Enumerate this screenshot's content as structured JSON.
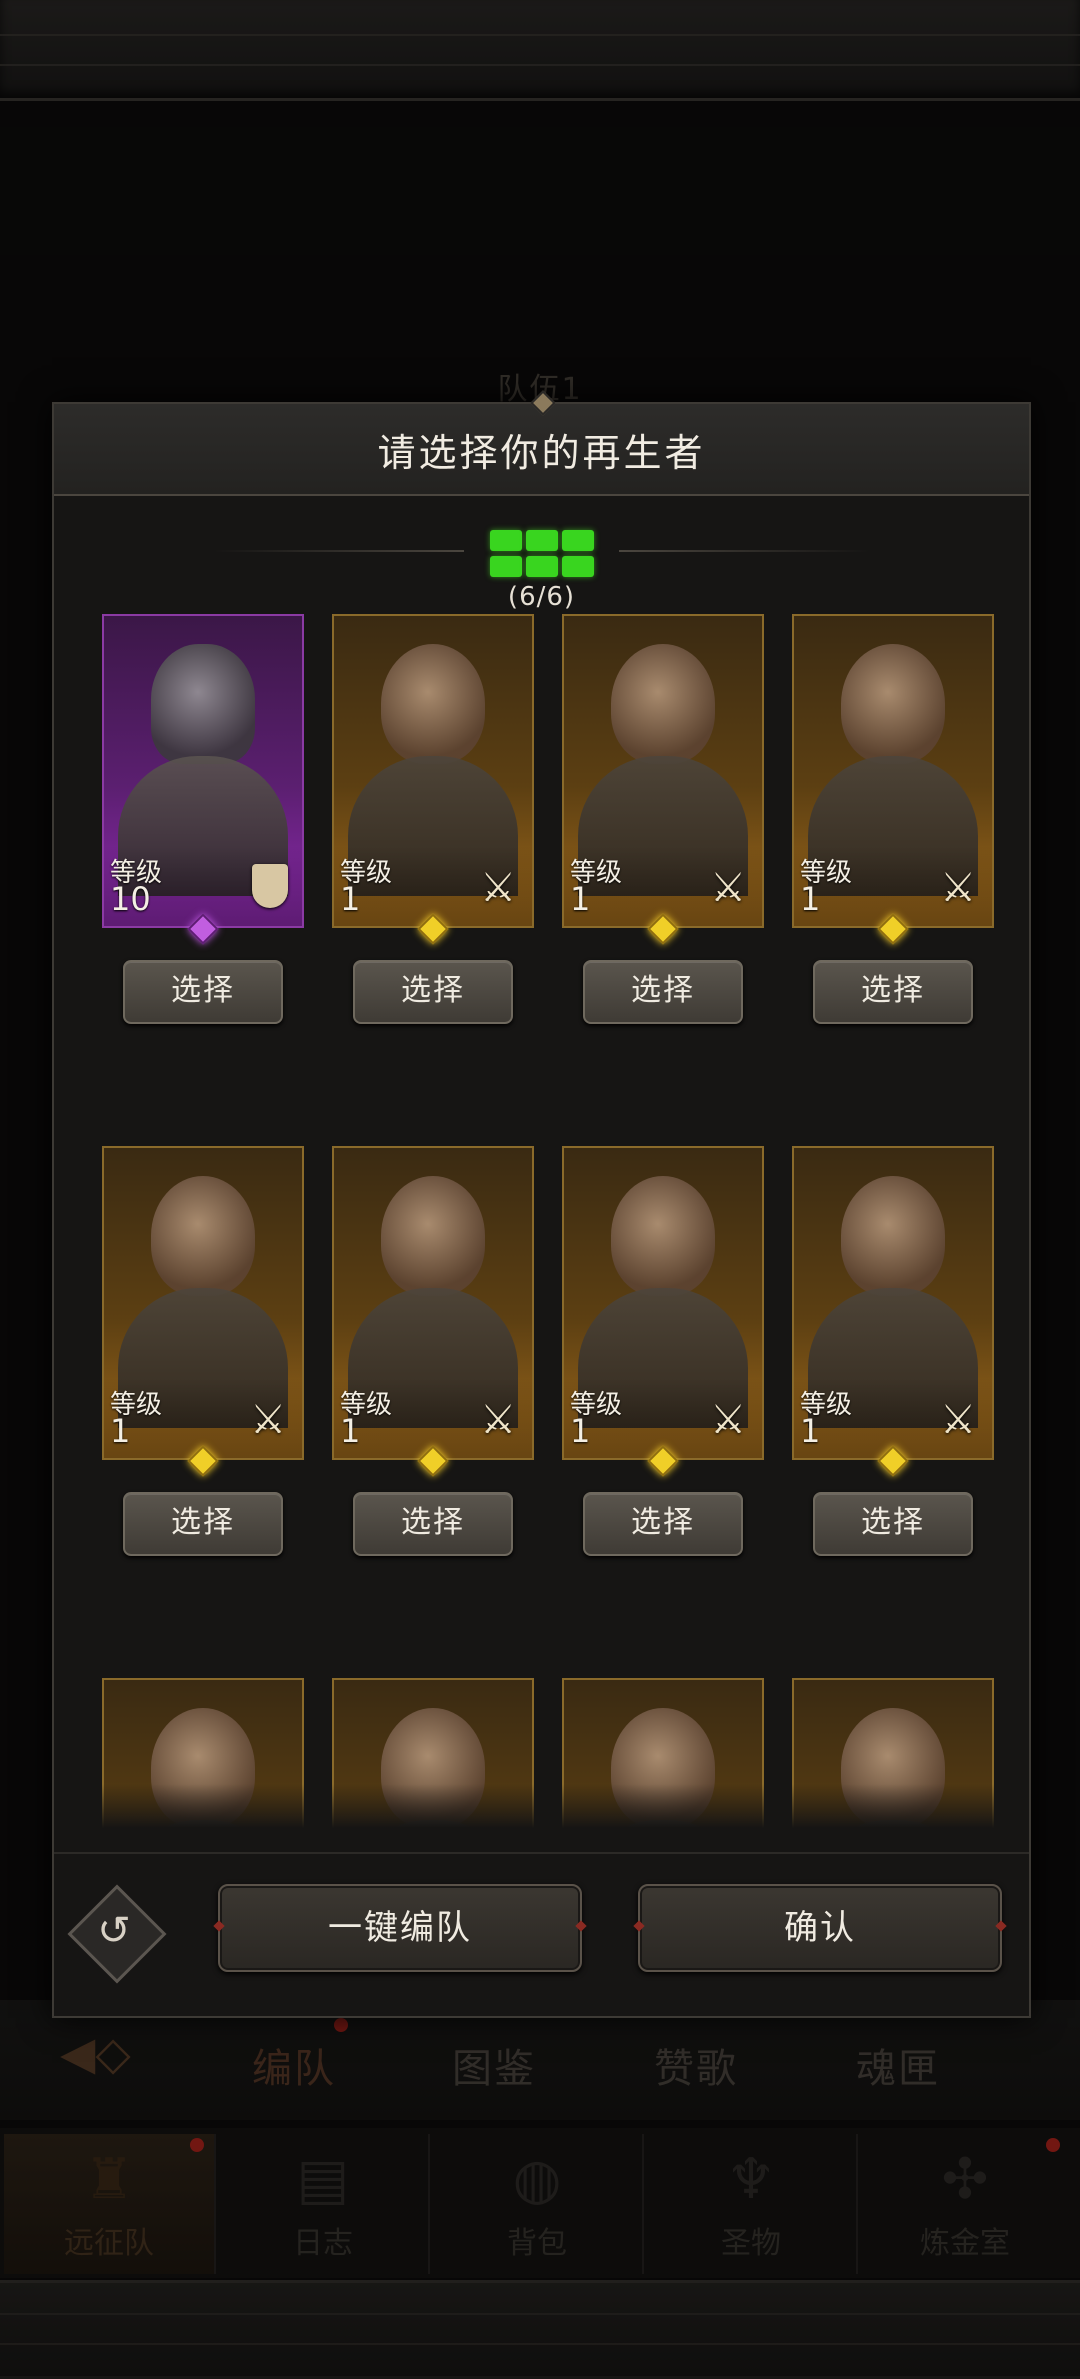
{
  "background": {
    "team_title": "队伍1",
    "sub_tabs": [
      "编队",
      "图鉴",
      "赞歌",
      "魂匣"
    ],
    "nav_items": [
      {
        "label": "远征队",
        "icon": "helmet-icon"
      },
      {
        "label": "日志",
        "icon": "scroll-icon"
      },
      {
        "label": "背包",
        "icon": "bag-icon"
      },
      {
        "label": "圣物",
        "icon": "torch-icon"
      },
      {
        "label": "炼金室",
        "icon": "alchemy-icon"
      }
    ]
  },
  "modal": {
    "title": "请选择你的再生者",
    "slots": {
      "filled": 6,
      "total": 6,
      "text": "(6/6)"
    },
    "level_label": "等级",
    "select_label": "选择",
    "characters": [
      {
        "level": "10",
        "rarity": "purple",
        "class_icon": "shield-icon"
      },
      {
        "level": "1",
        "rarity": "gold",
        "class_icon": "sword-icon"
      },
      {
        "level": "1",
        "rarity": "gold",
        "class_icon": "sword-icon"
      },
      {
        "level": "1",
        "rarity": "gold",
        "class_icon": "sword-icon"
      },
      {
        "level": "1",
        "rarity": "gold",
        "class_icon": "sword-icon"
      },
      {
        "level": "1",
        "rarity": "gold",
        "class_icon": "sword-icon"
      },
      {
        "level": "1",
        "rarity": "gold",
        "class_icon": "sword-icon"
      },
      {
        "level": "1",
        "rarity": "gold",
        "class_icon": "sword-icon"
      },
      {
        "level": "",
        "rarity": "gold",
        "class_icon": ""
      },
      {
        "level": "",
        "rarity": "gold",
        "class_icon": ""
      },
      {
        "level": "",
        "rarity": "gold",
        "class_icon": ""
      },
      {
        "level": "",
        "rarity": "gold",
        "class_icon": ""
      }
    ],
    "auto_team_label": "一键编队",
    "confirm_label": "确认"
  },
  "colors": {
    "slot_green": "#39d51f",
    "gold_border": "#8a6a2a",
    "purple_border": "#8b3aa4"
  }
}
